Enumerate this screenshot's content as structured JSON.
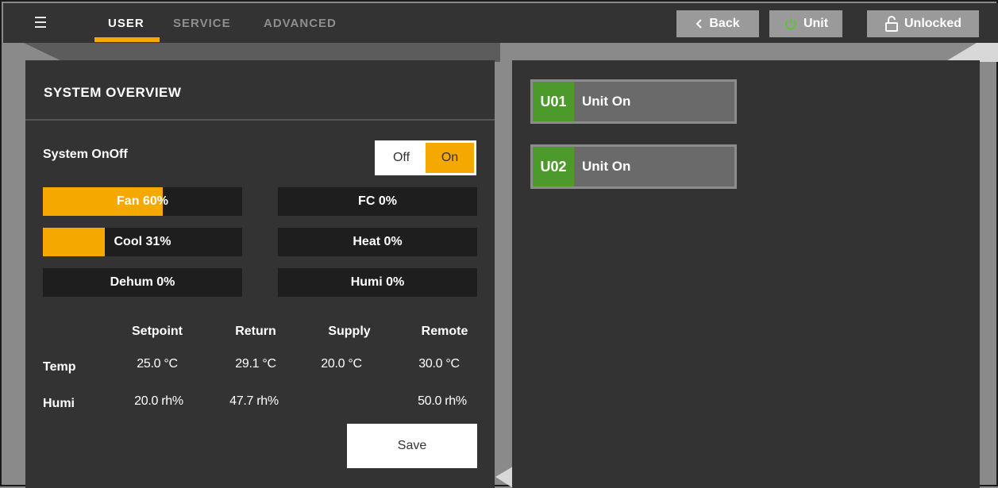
{
  "header": {
    "tabs": [
      {
        "label": "USER",
        "active": true
      },
      {
        "label": "SERVICE",
        "active": false
      },
      {
        "label": "ADVANCED",
        "active": false
      }
    ],
    "buttons": {
      "back": "Back",
      "unit": "Unit",
      "lock": "Unlocked"
    },
    "icons": {
      "menu": "hamburger-menu-icon",
      "back": "chevron-left-icon",
      "unit": "power-icon",
      "lock": "unlocked-padlock-icon"
    }
  },
  "overview": {
    "title": "SYSTEM OVERVIEW",
    "system_onoff": {
      "label": "System OnOff",
      "off_label": "Off",
      "on_label": "On",
      "selected": "On"
    },
    "bars": [
      {
        "label": "Fan 60%",
        "percent": 60
      },
      {
        "label": "FC 0%",
        "percent": 0
      },
      {
        "label": "Cool 31%",
        "percent": 31
      },
      {
        "label": "Heat 0%",
        "percent": 0
      },
      {
        "label": "Dehum 0%",
        "percent": 0
      },
      {
        "label": "Humi 0%",
        "percent": 0
      }
    ],
    "table": {
      "columns": [
        "Setpoint",
        "Return",
        "Supply",
        "Remote"
      ],
      "rows": [
        {
          "label": "Temp",
          "values": [
            "25.0 °C",
            "29.1 °C",
            "20.0 °C",
            "30.0 °C"
          ]
        },
        {
          "label": "Humi",
          "values": [
            "20.0 rh%",
            "47.7 rh%",
            "",
            "50.0 rh%"
          ]
        }
      ]
    },
    "save_label": "Save"
  },
  "units": [
    {
      "code": "U01",
      "status": "Unit On"
    },
    {
      "code": "U02",
      "status": "Unit On"
    }
  ],
  "colors": {
    "accent": "#f5a800",
    "unit_on": "#4d9a2c",
    "panel": "#333333",
    "topbar": "#333333",
    "button": "#9a9a9a"
  }
}
